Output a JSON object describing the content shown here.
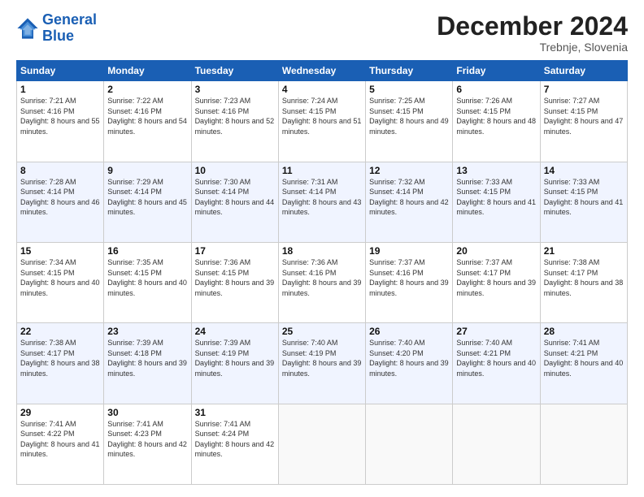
{
  "header": {
    "logo_line1": "General",
    "logo_line2": "Blue",
    "month": "December 2024",
    "location": "Trebnje, Slovenia"
  },
  "weekdays": [
    "Sunday",
    "Monday",
    "Tuesday",
    "Wednesday",
    "Thursday",
    "Friday",
    "Saturday"
  ],
  "weeks": [
    [
      {
        "day": "1",
        "sunrise": "7:21 AM",
        "sunset": "4:16 PM",
        "daylight": "8 hours and 55 minutes."
      },
      {
        "day": "2",
        "sunrise": "7:22 AM",
        "sunset": "4:16 PM",
        "daylight": "8 hours and 54 minutes."
      },
      {
        "day": "3",
        "sunrise": "7:23 AM",
        "sunset": "4:16 PM",
        "daylight": "8 hours and 52 minutes."
      },
      {
        "day": "4",
        "sunrise": "7:24 AM",
        "sunset": "4:15 PM",
        "daylight": "8 hours and 51 minutes."
      },
      {
        "day": "5",
        "sunrise": "7:25 AM",
        "sunset": "4:15 PM",
        "daylight": "8 hours and 49 minutes."
      },
      {
        "day": "6",
        "sunrise": "7:26 AM",
        "sunset": "4:15 PM",
        "daylight": "8 hours and 48 minutes."
      },
      {
        "day": "7",
        "sunrise": "7:27 AM",
        "sunset": "4:15 PM",
        "daylight": "8 hours and 47 minutes."
      }
    ],
    [
      {
        "day": "8",
        "sunrise": "7:28 AM",
        "sunset": "4:14 PM",
        "daylight": "8 hours and 46 minutes."
      },
      {
        "day": "9",
        "sunrise": "7:29 AM",
        "sunset": "4:14 PM",
        "daylight": "8 hours and 45 minutes."
      },
      {
        "day": "10",
        "sunrise": "7:30 AM",
        "sunset": "4:14 PM",
        "daylight": "8 hours and 44 minutes."
      },
      {
        "day": "11",
        "sunrise": "7:31 AM",
        "sunset": "4:14 PM",
        "daylight": "8 hours and 43 minutes."
      },
      {
        "day": "12",
        "sunrise": "7:32 AM",
        "sunset": "4:14 PM",
        "daylight": "8 hours and 42 minutes."
      },
      {
        "day": "13",
        "sunrise": "7:33 AM",
        "sunset": "4:15 PM",
        "daylight": "8 hours and 41 minutes."
      },
      {
        "day": "14",
        "sunrise": "7:33 AM",
        "sunset": "4:15 PM",
        "daylight": "8 hours and 41 minutes."
      }
    ],
    [
      {
        "day": "15",
        "sunrise": "7:34 AM",
        "sunset": "4:15 PM",
        "daylight": "8 hours and 40 minutes."
      },
      {
        "day": "16",
        "sunrise": "7:35 AM",
        "sunset": "4:15 PM",
        "daylight": "8 hours and 40 minutes."
      },
      {
        "day": "17",
        "sunrise": "7:36 AM",
        "sunset": "4:15 PM",
        "daylight": "8 hours and 39 minutes."
      },
      {
        "day": "18",
        "sunrise": "7:36 AM",
        "sunset": "4:16 PM",
        "daylight": "8 hours and 39 minutes."
      },
      {
        "day": "19",
        "sunrise": "7:37 AM",
        "sunset": "4:16 PM",
        "daylight": "8 hours and 39 minutes."
      },
      {
        "day": "20",
        "sunrise": "7:37 AM",
        "sunset": "4:17 PM",
        "daylight": "8 hours and 39 minutes."
      },
      {
        "day": "21",
        "sunrise": "7:38 AM",
        "sunset": "4:17 PM",
        "daylight": "8 hours and 38 minutes."
      }
    ],
    [
      {
        "day": "22",
        "sunrise": "7:38 AM",
        "sunset": "4:17 PM",
        "daylight": "8 hours and 38 minutes."
      },
      {
        "day": "23",
        "sunrise": "7:39 AM",
        "sunset": "4:18 PM",
        "daylight": "8 hours and 39 minutes."
      },
      {
        "day": "24",
        "sunrise": "7:39 AM",
        "sunset": "4:19 PM",
        "daylight": "8 hours and 39 minutes."
      },
      {
        "day": "25",
        "sunrise": "7:40 AM",
        "sunset": "4:19 PM",
        "daylight": "8 hours and 39 minutes."
      },
      {
        "day": "26",
        "sunrise": "7:40 AM",
        "sunset": "4:20 PM",
        "daylight": "8 hours and 39 minutes."
      },
      {
        "day": "27",
        "sunrise": "7:40 AM",
        "sunset": "4:21 PM",
        "daylight": "8 hours and 40 minutes."
      },
      {
        "day": "28",
        "sunrise": "7:41 AM",
        "sunset": "4:21 PM",
        "daylight": "8 hours and 40 minutes."
      }
    ],
    [
      {
        "day": "29",
        "sunrise": "7:41 AM",
        "sunset": "4:22 PM",
        "daylight": "8 hours and 41 minutes."
      },
      {
        "day": "30",
        "sunrise": "7:41 AM",
        "sunset": "4:23 PM",
        "daylight": "8 hours and 42 minutes."
      },
      {
        "day": "31",
        "sunrise": "7:41 AM",
        "sunset": "4:24 PM",
        "daylight": "8 hours and 42 minutes."
      },
      null,
      null,
      null,
      null
    ]
  ]
}
